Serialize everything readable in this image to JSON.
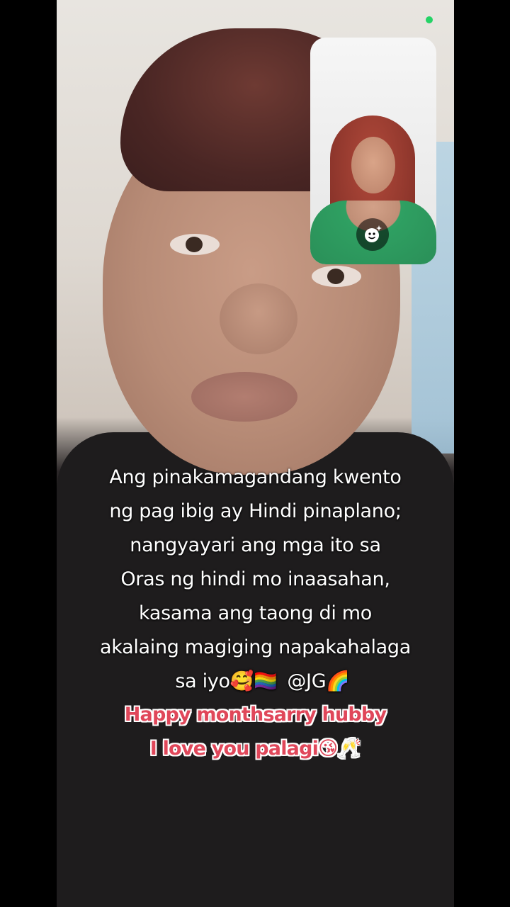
{
  "status": {
    "indicator_color": "#25d366"
  },
  "pip": {
    "effect_icon": "face-sparkle-icon"
  },
  "caption": {
    "lines": [
      "Ang pinakamagandang kwento",
      "ng pag ibig ay Hindi pinaplano;",
      "nangyayari ang mga ito sa",
      "Oras ng hindi mo inaasahan,",
      "kasama ang taong di mo",
      "akalaing magiging napakahalaga"
    ],
    "last_line": "sa iyo🥰🏳️‍🌈",
    "mention": "@JG🌈",
    "pink_lines": [
      "Happy monthsarry hubby",
      "I love you palagi😘🥂"
    ],
    "pink_color": "#e0475a"
  }
}
